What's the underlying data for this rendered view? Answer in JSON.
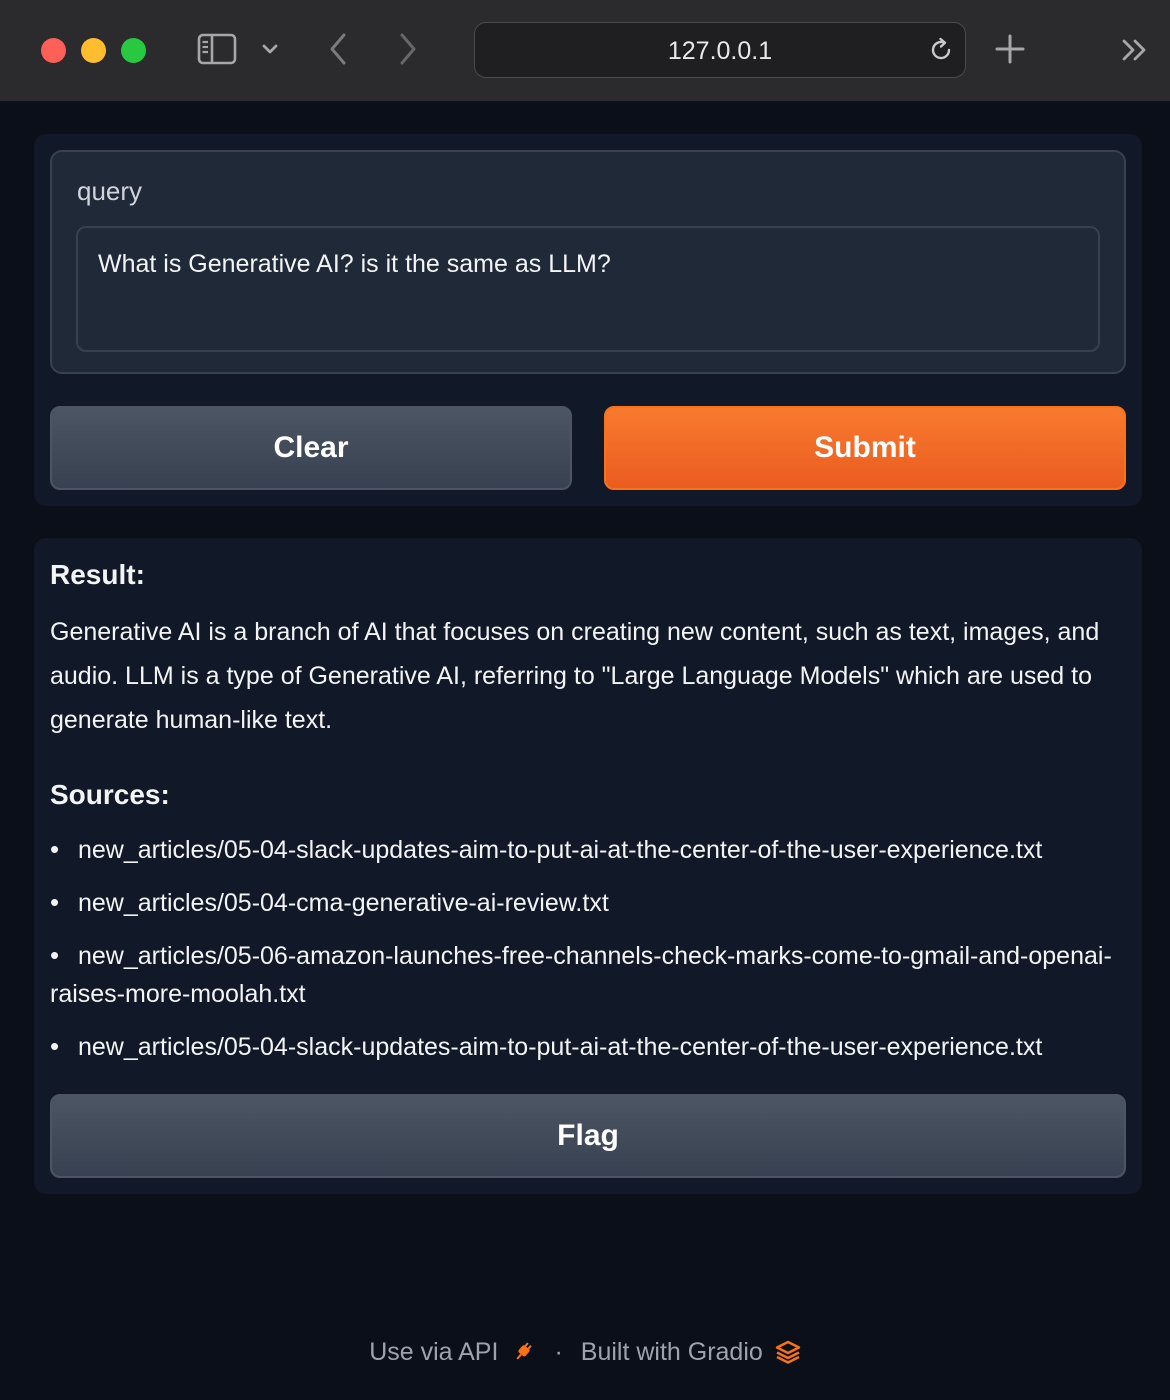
{
  "browser": {
    "url": "127.0.0.1",
    "icons": [
      "sidebar-icon",
      "chevron-down-icon",
      "back-chevron-icon",
      "forward-chevron-icon",
      "reload-icon",
      "plus-icon",
      "double-chevron-right-icon"
    ]
  },
  "input_panel": {
    "query_label": "query",
    "query_value": "What is Generative AI? is it the same as LLM?",
    "clear_label": "Clear",
    "submit_label": "Submit"
  },
  "output_panel": {
    "result_heading": "Result:",
    "result_text": "Generative AI is a branch of AI that focuses on creating new content, such as text, images, and audio. LLM is a type of Generative AI, referring to \"Large Language Models\" which are used to generate human-like text.",
    "sources_heading": "Sources:",
    "sources": [
      "new_articles/05-04-slack-updates-aim-to-put-ai-at-the-center-of-the-user-experience.txt",
      "new_articles/05-04-cma-generative-ai-review.txt",
      "new_articles/05-06-amazon-launches-free-channels-check-marks-come-to-gmail-and-openai-raises-more-moolah.txt",
      "new_articles/05-04-slack-updates-aim-to-put-ai-at-the-center-of-the-user-experience.txt"
    ],
    "flag_label": "Flag"
  },
  "footer": {
    "api_label": "Use via API",
    "separator": "·",
    "built_label": "Built with Gradio"
  },
  "colors": {
    "page_bg": "#0b0f19",
    "panel_bg": "#111827",
    "block_bg": "#1f2937",
    "accent": "#f97316",
    "secondary_button": "#4b5563"
  }
}
